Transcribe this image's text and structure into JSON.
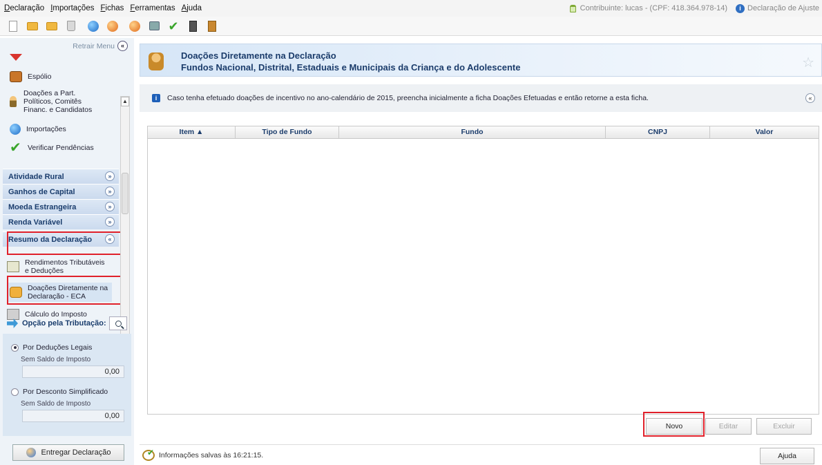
{
  "menubar": {
    "items": [
      "Declaração",
      "Importações",
      "Fichas",
      "Ferramentas",
      "Ajuda"
    ],
    "contribuinte": "Contribuinte: lucas - (CPF: 418.364.978-14)",
    "declaracao_tipo": "Declaração de Ajuste"
  },
  "toolbar": {
    "icons": [
      "new-document-icon",
      "open-folder-icon",
      "folder-icon",
      "trash-icon",
      "globe-icon",
      "globe-orange-icon",
      "globe-color-icon",
      "printer-icon",
      "check-icon",
      "calculator-icon",
      "book-icon"
    ]
  },
  "left_panel": {
    "retrair_label": "Retrair Menu",
    "items": [
      {
        "label": "Espólio"
      },
      {
        "label": "Doações a Part. Políticos, Comitês Financ. e Candidatos"
      },
      {
        "label": "Importações"
      },
      {
        "label": "Verificar Pendências"
      }
    ],
    "sections": [
      "Atividade Rural",
      "Ganhos de Capital",
      "Moeda Estrangeira",
      "Renda Variável",
      "Resumo da Declaração"
    ],
    "resumo_items": [
      {
        "label": "Rendimentos Tributáveis e Deduções"
      },
      {
        "label": "Doações Diretamente na Declaração - ECA"
      },
      {
        "label": "Cálculo do Imposto"
      }
    ],
    "opcao_label": "Opção pela Tributação:",
    "deducoes_legais": {
      "label": "Por Deduções Legais",
      "sub": "Sem Saldo de Imposto",
      "value": "0,00"
    },
    "desconto_simplificado": {
      "label": "Por Desconto Simplificado",
      "sub": "Sem Saldo de Imposto",
      "value": "0,00"
    },
    "entregar_label": "Entregar Declaração"
  },
  "main": {
    "title_line1": "Doações Diretamente na Declaração",
    "title_line2": "Fundos Nacional, Distrital, Estaduais e Municipais da Criança e do Adolescente",
    "info_text": "Caso tenha efetuado doações de incentivo no ano-calendário de 2015, preencha inicialmente a ficha Doações Efetuadas e então retorne a esta ficha.",
    "columns": [
      "Item ▲",
      "Tipo de Fundo",
      "Fundo",
      "CNPJ",
      "Valor"
    ],
    "rows": [],
    "buttons": {
      "novo": "Novo",
      "editar": "Editar",
      "excluir": "Excluir",
      "ajuda": "Ajuda"
    },
    "status": "Informações salvas às 16:21:15."
  }
}
